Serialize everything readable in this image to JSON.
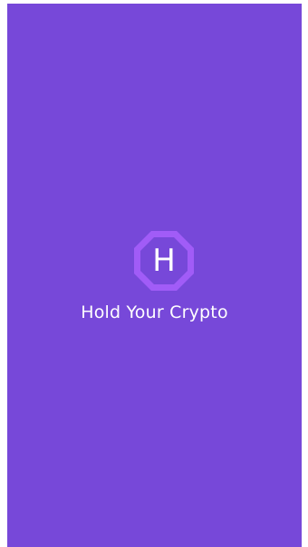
{
  "splash": {
    "logo_letter": "H",
    "logo_icon": "octagon-h-logo-icon",
    "app_name": "Hold Your Crypto"
  },
  "colors": {
    "background": "#7748d9",
    "logo_ring": "#a15cf7",
    "logo_fill": "#7748d9",
    "text": "#ffffff"
  }
}
